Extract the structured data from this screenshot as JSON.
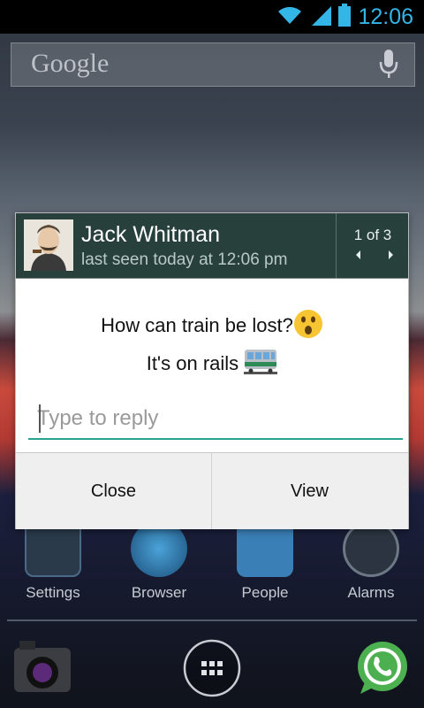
{
  "status_bar": {
    "time": "12:06",
    "colors": {
      "accent": "#33b5e5"
    },
    "icons": [
      "wifi-icon",
      "signal-icon",
      "battery-icon"
    ]
  },
  "search_bar": {
    "logo_text": "Google",
    "icons": [
      "mic-icon"
    ]
  },
  "home_screen": {
    "apps": [
      {
        "label": "Settings",
        "icon": "settings-icon"
      },
      {
        "label": "Browser",
        "icon": "globe-icon"
      },
      {
        "label": "People",
        "icon": "people-icon"
      },
      {
        "label": "Alarms",
        "icon": "clock-icon"
      }
    ],
    "dock": [
      {
        "icon": "camera-icon"
      },
      {
        "icon": "app-drawer-icon"
      },
      {
        "icon": "whatsapp-icon"
      }
    ]
  },
  "dialog": {
    "contact_name": "Jack Whitman",
    "last_seen": "last seen today at 12:06 pm",
    "page_counter": "1 of 3",
    "messages": [
      {
        "text": "How can train be lost?",
        "emoji": "astonished-face-emoji"
      },
      {
        "text": "It's on rails",
        "emoji": "train-emoji"
      }
    ],
    "reply_placeholder": "Type to reply",
    "reply_value": "",
    "buttons": {
      "close": "Close",
      "view": "View"
    },
    "colors": {
      "header_bg": "#27403c",
      "input_underline": "#2aa197"
    }
  }
}
